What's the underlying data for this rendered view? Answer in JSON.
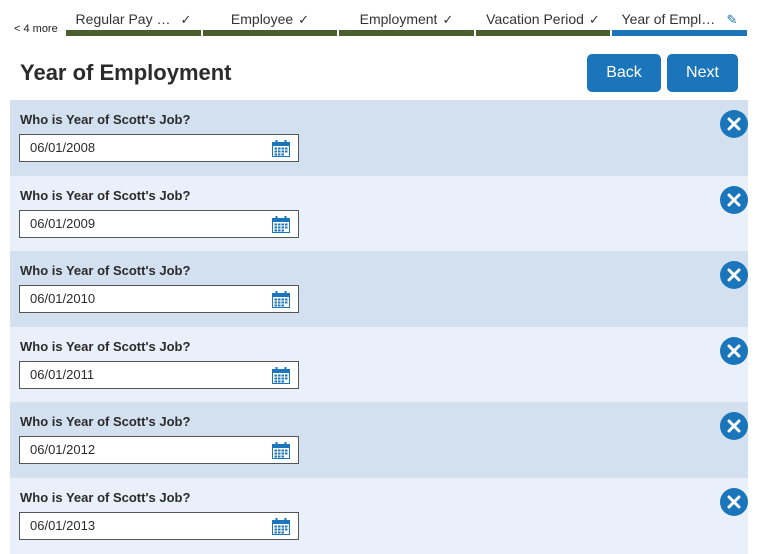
{
  "stepper": {
    "more_label": "< 4 more",
    "steps": [
      {
        "label": "Regular Pay Day",
        "state": "done",
        "mark": "✓"
      },
      {
        "label": "Employee",
        "state": "done",
        "mark": "✓"
      },
      {
        "label": "Employment",
        "state": "done",
        "mark": "✓"
      },
      {
        "label": "Vacation Period",
        "state": "done",
        "mark": "✓"
      },
      {
        "label": "Year of Employment",
        "state": "active",
        "mark": "✎"
      }
    ]
  },
  "header": {
    "title": "Year of Employment",
    "back_label": "Back",
    "next_label": "Next"
  },
  "entries": [
    {
      "question": "Who is Year of Scott's Job?",
      "date": "06/01/2008"
    },
    {
      "question": "Who is Year of Scott's Job?",
      "date": "06/01/2009"
    },
    {
      "question": "Who is Year of Scott's Job?",
      "date": "06/01/2010"
    },
    {
      "question": "Who is Year of Scott's Job?",
      "date": "06/01/2011"
    },
    {
      "question": "Who is Year of Scott's Job?",
      "date": "06/01/2012"
    },
    {
      "question": "Who is Year of Scott's Job?",
      "date": "06/01/2013"
    }
  ],
  "icons": {
    "step_done": "checkmark-icon",
    "step_active": "pencil-icon",
    "date_picker": "calendar-icon",
    "remove": "close-icon"
  },
  "colors": {
    "accent": "#1b75bb",
    "step_done_bar": "#4a5e2e",
    "row_shade": "#d3e0f0",
    "row_light": "#e9f0f9"
  }
}
